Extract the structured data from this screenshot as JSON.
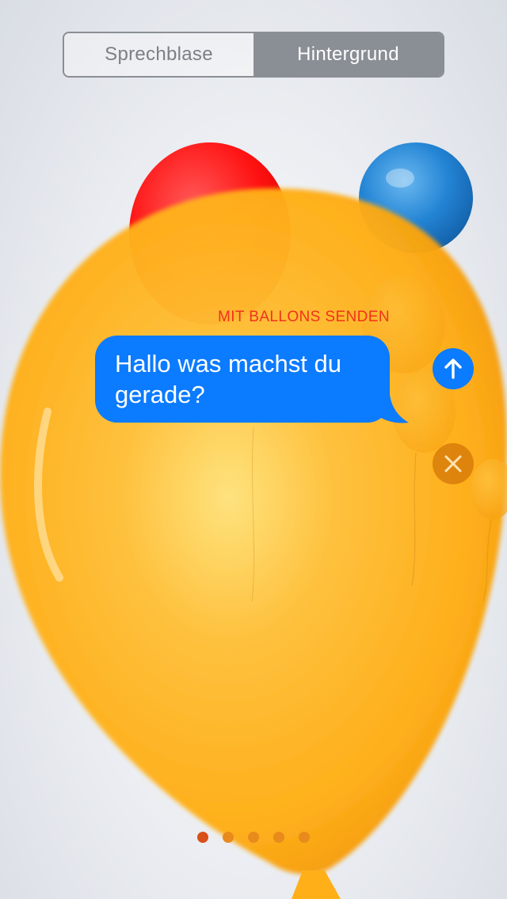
{
  "segmented_control": {
    "segments": [
      {
        "label": "Sprechblase",
        "selected": false
      },
      {
        "label": "Hintergrund",
        "selected": true
      }
    ]
  },
  "effect": {
    "label": "MIT BALLONS SENDEN"
  },
  "message": {
    "line1": "Hallo was machst du",
    "line2": "gerade?"
  },
  "buttons": {
    "send_icon": "arrow-up-icon",
    "cancel_icon": "close-icon"
  },
  "page_indicator": {
    "total": 5,
    "current": 1
  },
  "colors": {
    "bubble": "#0b7bff",
    "effect_label": "#f0321e",
    "balloon_yellow": "#ffb019",
    "balloon_red": "#ff1a1a",
    "balloon_blue": "#1f7fd0",
    "segment_selected": "#8a8e95"
  }
}
